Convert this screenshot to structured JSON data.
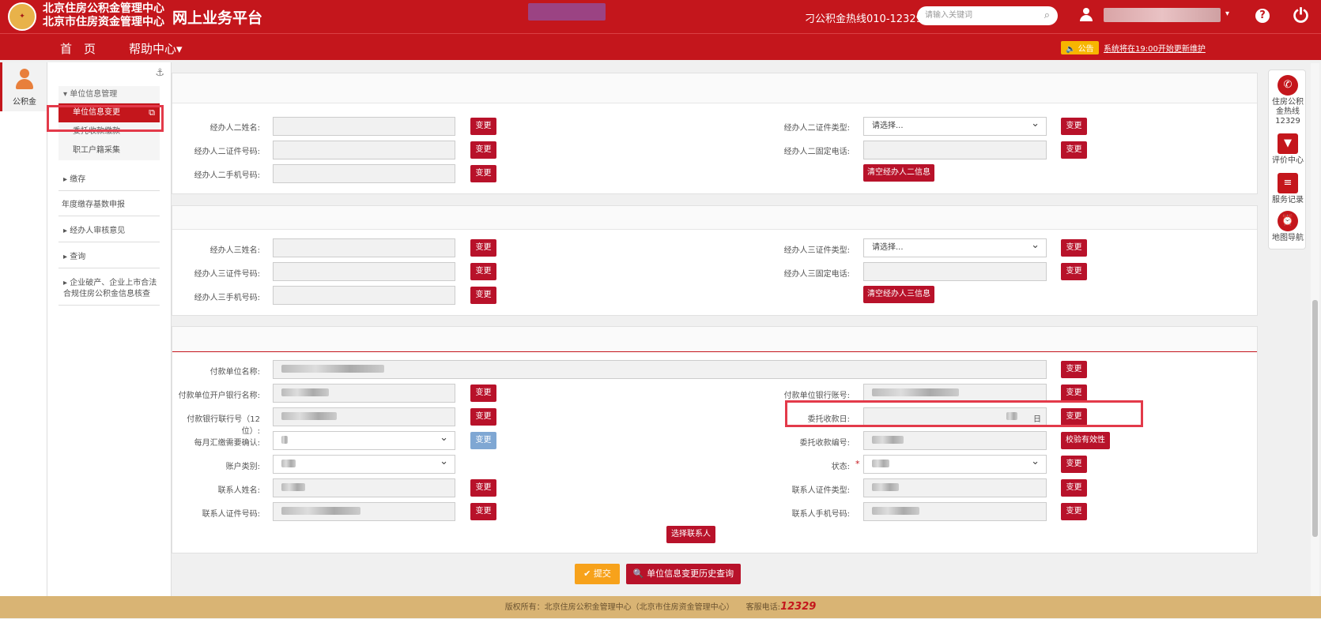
{
  "header": {
    "org_line1": "北京住房公积金管理中心",
    "org_line2": "北京市住房资金管理中心",
    "platform_title": "网上业务平台",
    "hotline": "刁公积金热线010-12329。",
    "search_placeholder": "请输入关键词",
    "help_label": "?"
  },
  "nav": {
    "home": "首　页",
    "help_center": "帮助中心▾",
    "notice_badge": "🔈 公告",
    "notice_text": "系统将在19:00开始更新维护"
  },
  "left_rail": {
    "label": "公积金"
  },
  "menu": {
    "group_title": "单位信息管理",
    "items": [
      "单位信息变更",
      "委托收款缴款",
      "职工户籍采集"
    ],
    "sections": [
      "缴存",
      "年度缴存基数申报",
      "经办人审核意见",
      "查询",
      "企业破产、企业上市合法合规住房公积金信息核查"
    ]
  },
  "agent2": {
    "name_label": "经办人二姓名:",
    "id_no_label": "经办人二证件号码:",
    "mobile_label": "经办人二手机号码:",
    "id_type_label": "经办人二证件类型:",
    "id_type_value": "请选择...",
    "phone_label": "经办人二固定电话:",
    "clear_button": "清空经办人二信息"
  },
  "agent3": {
    "name_label": "经办人三姓名:",
    "id_no_label": "经办人三证件号码:",
    "mobile_label": "经办人三手机号码:",
    "id_type_label": "经办人三证件类型:",
    "id_type_value": "请选择...",
    "phone_label": "经办人三固定电话:",
    "clear_button": "清空经办人三信息"
  },
  "payment": {
    "unit_name_label": "付款单位名称:",
    "bank_name_label": "付款单位开户银行名称:",
    "bank_no_label": "付款银行联行号（12位）:",
    "monthly_confirm_label": "每月汇缴需要确认:",
    "account_type_label": "账户类别:",
    "contact_name_label": "联系人姓名:",
    "contact_id_label": "联系人证件号码:",
    "account_no_label": "付款单位银行账号:",
    "collect_day_label": "委托收款日:",
    "collect_no_label": "委托收款编号:",
    "status_label": "状态:",
    "contact_id_type_label": "联系人证件类型:",
    "contact_mobile_label": "联系人手机号码:",
    "calendar_label": "日",
    "verify_button": "校验有效性",
    "select_contact_button": "选择联系人",
    "required_mark": "*"
  },
  "common": {
    "change_button": "变更"
  },
  "actions": {
    "submit": "✔ 提交",
    "history": "🔍 单位信息变更历史查询"
  },
  "right_rail": {
    "items": [
      {
        "label": "住房公积金热线12329",
        "icon": "phone-icon"
      },
      {
        "label": "评价中心",
        "icon": "evaluation-icon"
      },
      {
        "label": "服务记录",
        "icon": "record-icon"
      },
      {
        "label": "地图导航",
        "icon": "alarm-clock-icon"
      }
    ]
  },
  "footer": {
    "copyright": "版权所有：北京住房公积金管理中心（北京市住房资金管理中心）　　客服电话:",
    "service_phone": "12329"
  },
  "colors": {
    "brand_red": "#c4161c",
    "notice_yellow": "#f7b500",
    "submit_orange": "#f7a21b",
    "footer_tan": "#d9b474"
  }
}
